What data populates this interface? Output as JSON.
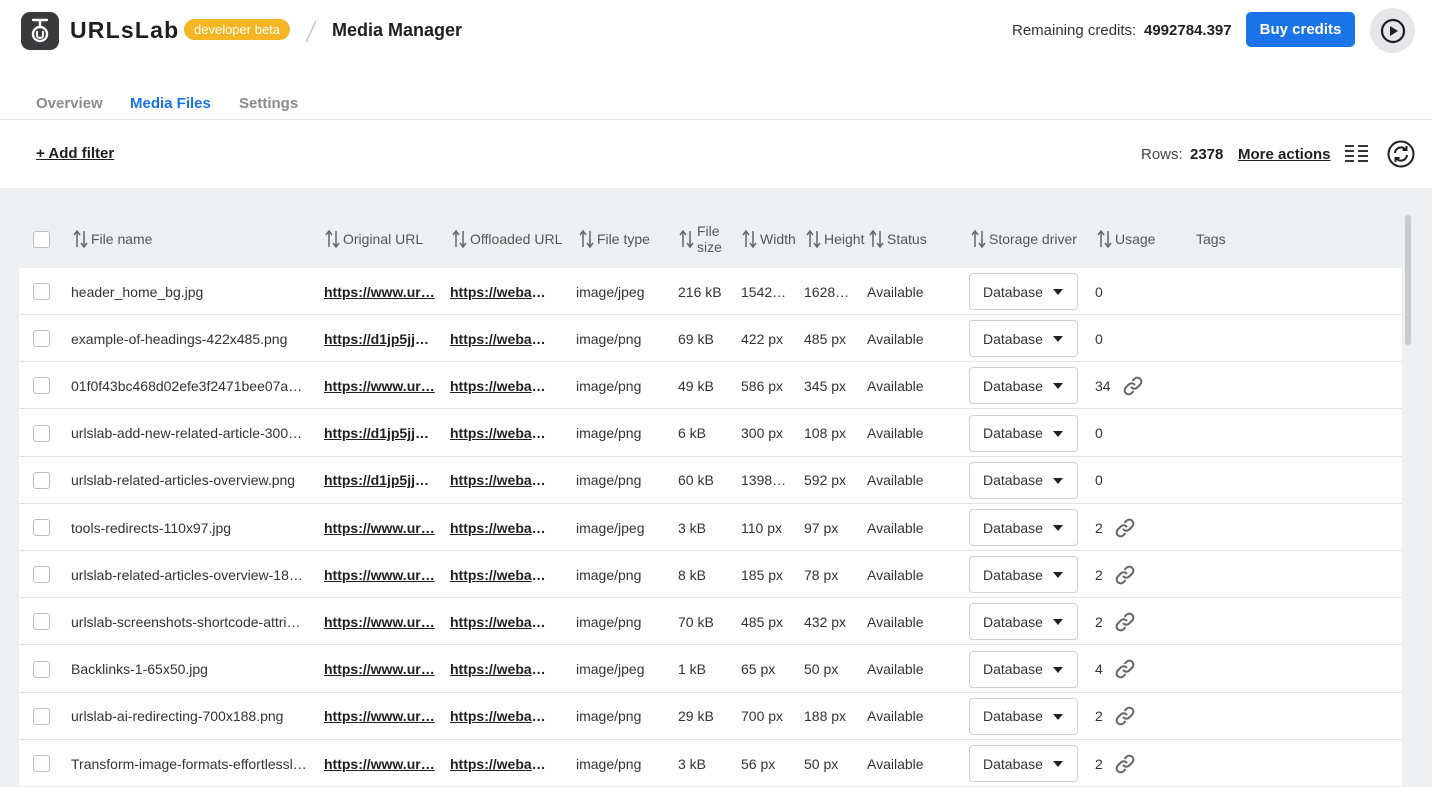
{
  "header": {
    "brand": "URLsLab",
    "badge": "developer beta",
    "title": "Media Manager",
    "credits_label": "Remaining credits:",
    "credits_value": "4992784.397",
    "buy_label": "Buy credits"
  },
  "tabs": [
    {
      "label": "Overview"
    },
    {
      "label": "Media Files"
    },
    {
      "label": "Settings"
    }
  ],
  "toolbar": {
    "add_filter": "+ Add filter",
    "rows_label": "Rows:",
    "rows_value": "2378",
    "more_actions": "More actions"
  },
  "columns": {
    "file_name": "File name",
    "original_url": "Original URL",
    "offloaded_url": "Offloaded URL",
    "file_type": "File type",
    "file_size_1": "File",
    "file_size_2": "size",
    "width": "Width",
    "height": "Height",
    "status": "Status",
    "storage_driver": "Storage driver",
    "usage": "Usage",
    "tags": "Tags"
  },
  "rows": [
    {
      "name": "header_home_bg.jpg",
      "orig": "https://www.ur…",
      "off": "https://webad…",
      "type": "image/jpeg",
      "size": "216 kB",
      "width": "1542…",
      "height": "1628…",
      "status": "Available",
      "driver": "Database",
      "usage": "0",
      "linked": false
    },
    {
      "name": "example-of-headings-422x485.png",
      "orig": "https://d1jp5jjh…",
      "off": "https://webad…",
      "type": "image/png",
      "size": "69 kB",
      "width": "422 px",
      "height": "485 px",
      "status": "Available",
      "driver": "Database",
      "usage": "0",
      "linked": false
    },
    {
      "name": "01f0f43bc468d02efe3f2471bee07a7…",
      "orig": "https://www.ur…",
      "off": "https://webad…",
      "type": "image/png",
      "size": "49 kB",
      "width": "586 px",
      "height": "345 px",
      "status": "Available",
      "driver": "Database",
      "usage": "34",
      "linked": true
    },
    {
      "name": "urlslab-add-new-related-article-300x…",
      "orig": "https://d1jp5jjh…",
      "off": "https://webad…",
      "type": "image/png",
      "size": "6 kB",
      "width": "300 px",
      "height": "108 px",
      "status": "Available",
      "driver": "Database",
      "usage": "0",
      "linked": false
    },
    {
      "name": "urlslab-related-articles-overview.png",
      "orig": "https://d1jp5jjh…",
      "off": "https://webad…",
      "type": "image/png",
      "size": "60 kB",
      "width": "1398…",
      "height": "592 px",
      "status": "Available",
      "driver": "Database",
      "usage": "0",
      "linked": false
    },
    {
      "name": "tools-redirects-110x97.jpg",
      "orig": "https://www.ur…",
      "off": "https://webad…",
      "type": "image/jpeg",
      "size": "3 kB",
      "width": "110 px",
      "height": "97 px",
      "status": "Available",
      "driver": "Database",
      "usage": "2",
      "linked": true
    },
    {
      "name": "urlslab-related-articles-overview-185…",
      "orig": "https://www.ur…",
      "off": "https://webad…",
      "type": "image/png",
      "size": "8 kB",
      "width": "185 px",
      "height": "78 px",
      "status": "Available",
      "driver": "Database",
      "usage": "2",
      "linked": true
    },
    {
      "name": "urlslab-screenshots-shortcode-attrib…",
      "orig": "https://www.ur…",
      "off": "https://webad…",
      "type": "image/png",
      "size": "70 kB",
      "width": "485 px",
      "height": "432 px",
      "status": "Available",
      "driver": "Database",
      "usage": "2",
      "linked": true
    },
    {
      "name": "Backlinks-1-65x50.jpg",
      "orig": "https://www.ur…",
      "off": "https://webad…",
      "type": "image/jpeg",
      "size": "1 kB",
      "width": "65 px",
      "height": "50 px",
      "status": "Available",
      "driver": "Database",
      "usage": "4",
      "linked": true
    },
    {
      "name": "urlslab-ai-redirecting-700x188.png",
      "orig": "https://www.ur…",
      "off": "https://webad…",
      "type": "image/png",
      "size": "29 kB",
      "width": "700 px",
      "height": "188 px",
      "status": "Available",
      "driver": "Database",
      "usage": "2",
      "linked": true
    },
    {
      "name": "Transform-image-formats-effortlessly…",
      "orig": "https://www.ur…",
      "off": "https://webad…",
      "type": "image/png",
      "size": "3 kB",
      "width": "56 px",
      "height": "50 px",
      "status": "Available",
      "driver": "Database",
      "usage": "2",
      "linked": true
    }
  ],
  "icons": {
    "logo": "urlslab-logo-icon",
    "play": "play-circle-icon",
    "sort": "sort-arrows-icon",
    "link": "link-icon",
    "columns": "column-list-icon",
    "refresh": "refresh-icon"
  },
  "colors": {
    "accent": "#1a73e8",
    "badge": "#f6b623",
    "table_bg": "#eeeff3"
  }
}
